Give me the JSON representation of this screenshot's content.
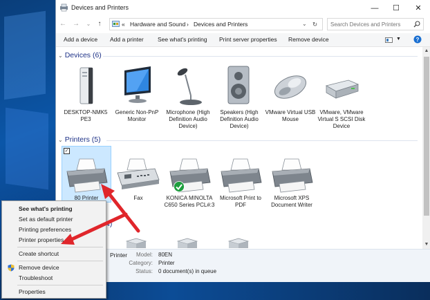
{
  "window": {
    "title": "Devices and Printers",
    "controls": {
      "minimize": "—",
      "maximize": "☐",
      "close": "✕"
    }
  },
  "address": {
    "back": "←",
    "forward": "→",
    "recent": "⌄",
    "up": "↑",
    "overflow": "«",
    "crumbs": [
      "Hardware and Sound",
      "Devices and Printers"
    ],
    "separator": "›",
    "dropdown": "⌄",
    "refresh": "↻",
    "search_placeholder": "Search Devices and Printers"
  },
  "toolbar": {
    "items": [
      "Add a device",
      "Add a printer",
      "See what's printing",
      "Print server properties",
      "Remove device"
    ]
  },
  "sections": {
    "devices": {
      "title": "Devices (6)"
    },
    "printers": {
      "title": "Printers (5)"
    },
    "unspecified": {
      "title_fragment": "4)"
    }
  },
  "devices": [
    {
      "label": "DESKTOP-NMK5 PE3",
      "icon": "computer-tower-icon"
    },
    {
      "label": "Generic Non-PnP Monitor",
      "icon": "monitor-icon"
    },
    {
      "label": "Microphone (High Definition Audio Device)",
      "icon": "microphone-icon"
    },
    {
      "label": "Speakers (High Definition Audio Device)",
      "icon": "speaker-icon"
    },
    {
      "label": "VMware Virtual USB Mouse",
      "icon": "mouse-icon"
    },
    {
      "label": "VMware, VMware Virtual S SCSI Disk Device",
      "icon": "disk-drive-icon"
    }
  ],
  "printers": [
    {
      "label": "80 Printer",
      "icon": "printer-icon",
      "selected": true
    },
    {
      "label": "Fax",
      "icon": "fax-icon"
    },
    {
      "label": "KONICA MINOLTA C650 Series PCL#:3",
      "icon": "printer-icon",
      "default": true
    },
    {
      "label": "Microsoft Print to PDF",
      "icon": "printer-icon"
    },
    {
      "label": "Microsoft XPS Document Writer",
      "icon": "printer-icon"
    }
  ],
  "details": {
    "name": "Printer",
    "model_label": "Model:",
    "model_value": "80EN",
    "category_label": "Category:",
    "category_value": "Printer",
    "status_label": "Status:",
    "status_value": "0 document(s) in queue"
  },
  "context_menu": {
    "items": [
      {
        "label": "See what's printing",
        "bold": true
      },
      {
        "label": "Set as default printer"
      },
      {
        "label": "Printing preferences"
      },
      {
        "label": "Printer properties"
      },
      {
        "label": "Create shortcut"
      },
      {
        "label": "Remove device",
        "shield": true
      },
      {
        "label": "Troubleshoot"
      },
      {
        "label": "Properties"
      }
    ]
  },
  "colors": {
    "section_header": "#1e3287",
    "selection_fill": "#cce8ff",
    "arrow": "#e0262b",
    "default_check": "#1e9e3e"
  }
}
